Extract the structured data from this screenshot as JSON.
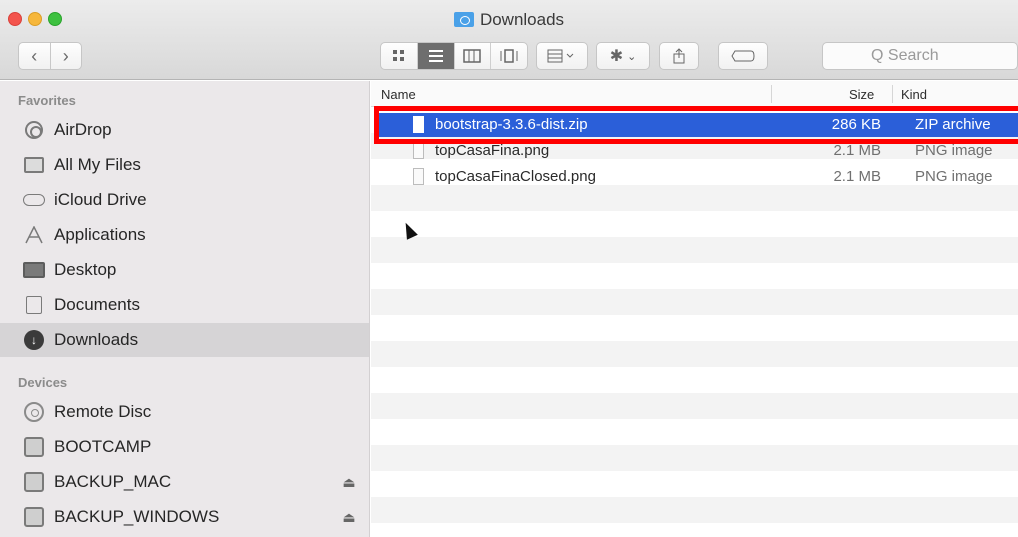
{
  "window": {
    "title": "Downloads"
  },
  "toolbar": {
    "back_icon": "chevron-left-icon",
    "forward_icon": "chevron-right-icon",
    "views": [
      "icon-view-icon",
      "list-view-icon",
      "column-view-icon",
      "cover-flow-icon"
    ],
    "arrange_icon": "arrange-grid-icon",
    "action_icon": "gear-icon",
    "share_icon": "share-icon",
    "tags_icon": "tag-icon",
    "search_placeholder": "Q Search"
  },
  "sidebar": {
    "favorites_header": "Favorites",
    "favorites": [
      {
        "label": "AirDrop",
        "icon": "airdrop-icon"
      },
      {
        "label": "All My Files",
        "icon": "all-files-icon"
      },
      {
        "label": "iCloud Drive",
        "icon": "cloud-icon"
      },
      {
        "label": "Applications",
        "icon": "applications-icon"
      },
      {
        "label": "Desktop",
        "icon": "desktop-icon"
      },
      {
        "label": "Documents",
        "icon": "documents-icon"
      },
      {
        "label": "Downloads",
        "icon": "downloads-icon",
        "selected": true
      }
    ],
    "devices_header": "Devices",
    "devices": [
      {
        "label": "Remote Disc",
        "icon": "disc-icon"
      },
      {
        "label": "BOOTCAMP",
        "icon": "drive-icon"
      },
      {
        "label": "BACKUP_MAC",
        "icon": "drive-icon",
        "eject": "⏏"
      },
      {
        "label": "BACKUP_WINDOWS",
        "icon": "drive-icon",
        "eject": "⏏"
      }
    ]
  },
  "list": {
    "columns": {
      "name": "Name",
      "size": "Size",
      "kind": "Kind"
    },
    "rows": [
      {
        "name": "bootstrap-3.3.6-dist.zip",
        "size": "286 KB",
        "kind": "ZIP archive",
        "selected": true
      },
      {
        "name": "topCasaFina.png",
        "size": "2.1 MB",
        "kind": "PNG image"
      },
      {
        "name": "topCasaFinaClosed.png",
        "size": "2.1 MB",
        "kind": "PNG image"
      }
    ]
  },
  "colors": {
    "selection": "#2b5fd9",
    "highlight_border": "#ff0000",
    "sidebar_bg": "#ebe8ea"
  }
}
